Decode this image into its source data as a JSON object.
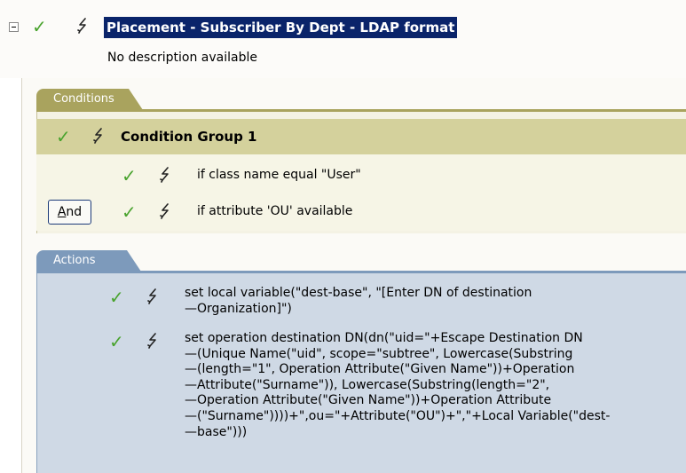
{
  "policy": {
    "title": "Placement - Subscriber By Dept - LDAP format",
    "description": "No description available"
  },
  "conditions": {
    "tab_label": "Conditions",
    "group_label": "Condition Group 1",
    "and_button_label": "And",
    "rows": [
      {
        "text": "if class name equal \"User\""
      },
      {
        "text": "if attribute 'OU' available"
      }
    ]
  },
  "actions": {
    "tab_label": "Actions",
    "rows": [
      {
        "lines": [
          "set local variable(\"dest-base\", \"[Enter DN of destination",
          "—Organization]\")"
        ]
      },
      {
        "lines": [
          "set operation destination DN(dn(\"uid=\"+Escape Destination DN",
          "—(Unique Name(\"uid\", scope=\"subtree\", Lowercase(Substring",
          "—(length=\"1\", Operation Attribute(\"Given Name\"))+Operation",
          "—Attribute(\"Surname\")), Lowercase(Substring(length=\"2\",",
          "—Operation Attribute(\"Given Name\"))+Operation Attribute",
          "—(\"Surname\"))))+\",ou=\"+Attribute(\"OU\")+\",\"+Local Variable(\"dest-",
          "—base\")))"
        ]
      }
    ]
  },
  "icons": {
    "check": "check-icon",
    "rule": "lightning-icon",
    "collapse": "collapse-icon"
  },
  "colors": {
    "title_highlight": "#0a246a",
    "check_green": "#49a32e",
    "conditions_tab": "#a9a35e",
    "condition_group_header": "#d4d19c",
    "actions_tab": "#7d9abb",
    "actions_background": "#cfd9e5"
  }
}
